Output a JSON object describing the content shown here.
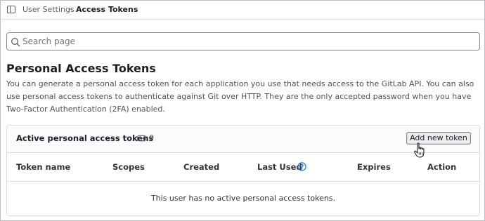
{
  "breadcrumb": {
    "items": [
      "User Settings",
      "Access Tokens"
    ],
    "separator": "›"
  },
  "search": {
    "placeholder": "Search page"
  },
  "page": {
    "title": "Personal Access Tokens",
    "description": "You can generate a personal access token for each application you use that needs access to the GitLab API. You can also use personal access tokens to authenticate against Git over HTTP. They are the only accepted password when you have Two-Factor Authentication (2FA) enabled."
  },
  "tokens_card": {
    "title": "Active personal access tokens",
    "count": "0",
    "add_button_label": "Add new token",
    "columns": [
      "Token name",
      "Scopes",
      "Created",
      "Last Used",
      "Expires",
      "Action"
    ],
    "empty_message": "This user has no active personal access tokens."
  },
  "icons": {
    "sidebar_toggle": "sidebar-toggle-icon",
    "search": "search-icon",
    "token": "token-icon",
    "help": "question-circle-icon",
    "cursor": "hand-pointer-cursor"
  },
  "colors": {
    "link_blue": "#1f75cb",
    "text_primary": "#1f1e24",
    "border": "#dcdcde",
    "button_bg": "#ececef"
  }
}
